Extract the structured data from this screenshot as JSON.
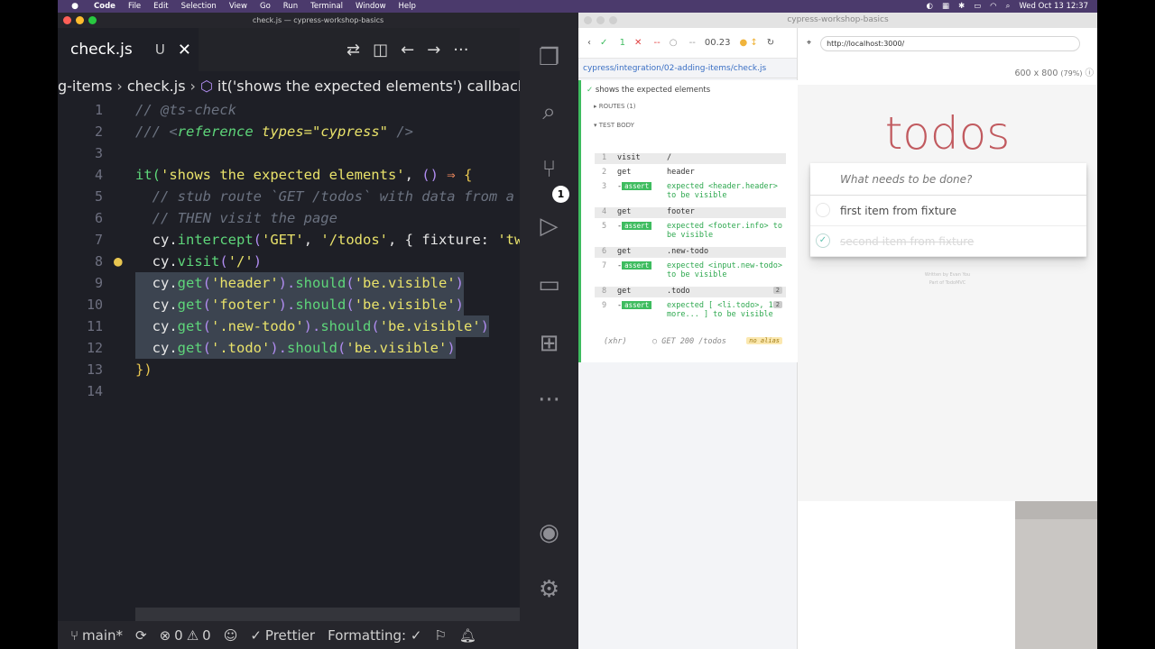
{
  "menubar": {
    "app": "Code",
    "items": [
      "File",
      "Edit",
      "Selection",
      "View",
      "Go",
      "Run",
      "Terminal",
      "Window",
      "Help"
    ],
    "clock": "Wed Oct 13  12:37"
  },
  "vscode": {
    "window_title": "check.js — cypress-workshop-basics",
    "tab": {
      "name": "check.js",
      "status": "U"
    },
    "breadcrumb": [
      "g-items",
      "check.js",
      "it('shows the expected elements') callback"
    ],
    "lines": [
      "1",
      "2",
      "3",
      "4",
      "5",
      "6",
      "7",
      "8",
      "9",
      "10",
      "11",
      "12",
      "13",
      "14"
    ],
    "code": {
      "l1": "// @ts-check",
      "l2a": "/// <",
      "l2b": "reference",
      "l2c": " types=",
      "l2d": "\"cypress\"",
      "l2e": " />",
      "l4a": "it(",
      "l4b": "'shows the expected elements'",
      "l4c": ", ",
      "l4d": "()",
      "l4e": " ⇒ ",
      "l4f": "{",
      "l5": "  // stub route `GET /todos` with data from a f",
      "l6": "  // THEN visit the page",
      "l7a": "  cy.",
      "l7b": "intercept",
      "l7c": "(",
      "l7d": "'GET'",
      "l7e": ", ",
      "l7f": "'/todos'",
      "l7g": ", { fixture: ",
      "l7h": "'two",
      "l8a": "  cy.",
      "l8b": "visit",
      "l8c": "(",
      "l8d": "'/'",
      "l8e": ")",
      "l9a": "  cy.",
      "l9b": "get",
      "l9c": "(",
      "l9d": "'header'",
      "l9e": ").",
      "l9f": "should",
      "l9g": "(",
      "l9h": "'be.visible'",
      "l9i": ")",
      "l10d": "'footer'",
      "l11d": "'.new-todo'",
      "l12d": "'.todo'",
      "l13": "})"
    },
    "status": {
      "branch": "main*",
      "errors": "0",
      "warnings": "0",
      "prettier": "Prettier",
      "formatting": "Formatting: ✓"
    },
    "scm_badge": "1"
  },
  "cypress": {
    "window_title": "cypress-workshop-basics",
    "passed": "1",
    "failed": "--",
    "pending": "--",
    "duration": "00.23",
    "spec_path": "cypress/integration/02-adding-items/check.js",
    "test_title": "shows the expected elements",
    "routes": "ROUTES (1)",
    "test_body": "TEST BODY",
    "url": "http://localhost:3000/",
    "viewport": "600 x 800",
    "viewport_pct": "(79%)",
    "commands": [
      {
        "n": "1",
        "name": "visit",
        "msg": "/"
      },
      {
        "n": "2",
        "name": "get",
        "msg": "header"
      },
      {
        "n": "3",
        "name": "assert",
        "msg": "expected <header.header> to be visible"
      },
      {
        "n": "4",
        "name": "get",
        "msg": "footer"
      },
      {
        "n": "5",
        "name": "assert",
        "msg": "expected <footer.info> to be visible"
      },
      {
        "n": "6",
        "name": "get",
        "msg": ".new-todo"
      },
      {
        "n": "7",
        "name": "assert",
        "msg": "expected <input.new-todo> to be visible"
      },
      {
        "n": "8",
        "name": "get",
        "msg": ".todo",
        "count": "2"
      },
      {
        "n": "9",
        "name": "assert",
        "msg": "expected [ <li.todo>, 1 more... ] to be visible",
        "count": "2"
      }
    ],
    "xhr": {
      "label": "(xhr)",
      "msg": "GET 200 /todos",
      "alias": "no alias"
    }
  },
  "todo": {
    "title": "todos",
    "placeholder": "What needs to be done?",
    "items": [
      {
        "text": "first item from fixture",
        "done": false
      },
      {
        "text": "second item from fixture",
        "done": true
      }
    ],
    "footer1": "Written by Evan You",
    "footer2": "Part of TodoMVC"
  }
}
